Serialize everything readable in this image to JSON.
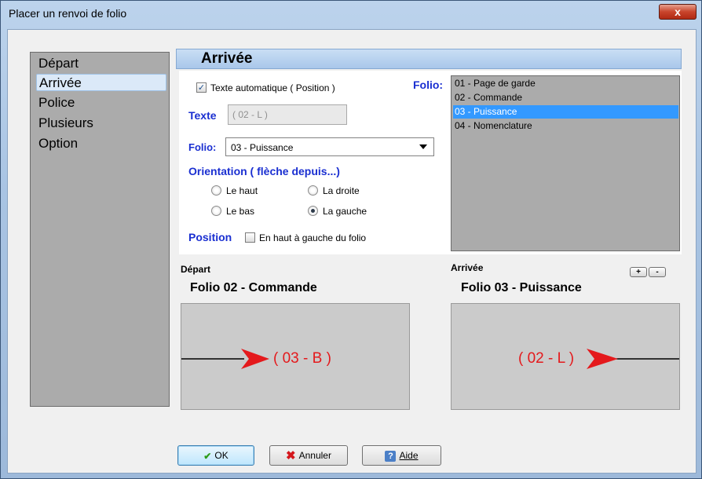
{
  "window": {
    "title": "Placer un renvoi de folio",
    "close_glyph": "x"
  },
  "nav": {
    "items": [
      {
        "label": "Départ"
      },
      {
        "label": "Arrivée"
      },
      {
        "label": "Police"
      },
      {
        "label": "Plusieurs"
      },
      {
        "label": "Option"
      }
    ],
    "selected": "Arrivée"
  },
  "section": {
    "title": "Arrivée",
    "auto_text_label": "Texte automatique ( Position )",
    "auto_text_checked": true,
    "texte_label": "Texte",
    "texte_value": "( 02 - L )",
    "folio_label": "Folio:",
    "folio_value": "03 - Puissance",
    "orientation_label": "Orientation ( flèche depuis...)",
    "orientation_options": [
      "Le haut",
      "La droite",
      "Le bas",
      "La gauche"
    ],
    "orientation_selected": "La gauche",
    "position_label": "Position",
    "position_option": "En haut à gauche du folio",
    "position_checked": false
  },
  "folio_list": {
    "label": "Folio:",
    "items": [
      "01 - Page de garde",
      "02 - Commande",
      "03 - Puissance",
      "04 - Nomenclature"
    ],
    "selected": "03 - Puissance"
  },
  "preview": {
    "depart_label": "Départ",
    "depart_folio": "Folio 02 - Commande",
    "depart_ref": "( 03 - B )",
    "arrivee_label": "Arrivée",
    "arrivee_folio": "Folio 03 - Puissance",
    "arrivee_ref": "( 02 - L )",
    "zoom_in": "+",
    "zoom_out": "-",
    "ref_color": "#e4191c"
  },
  "buttons": {
    "ok": "OK",
    "cancel": "Annuler",
    "help": "Aide"
  },
  "icons": {
    "ok": "check-icon",
    "cancel": "x-icon",
    "help": "help-icon"
  }
}
